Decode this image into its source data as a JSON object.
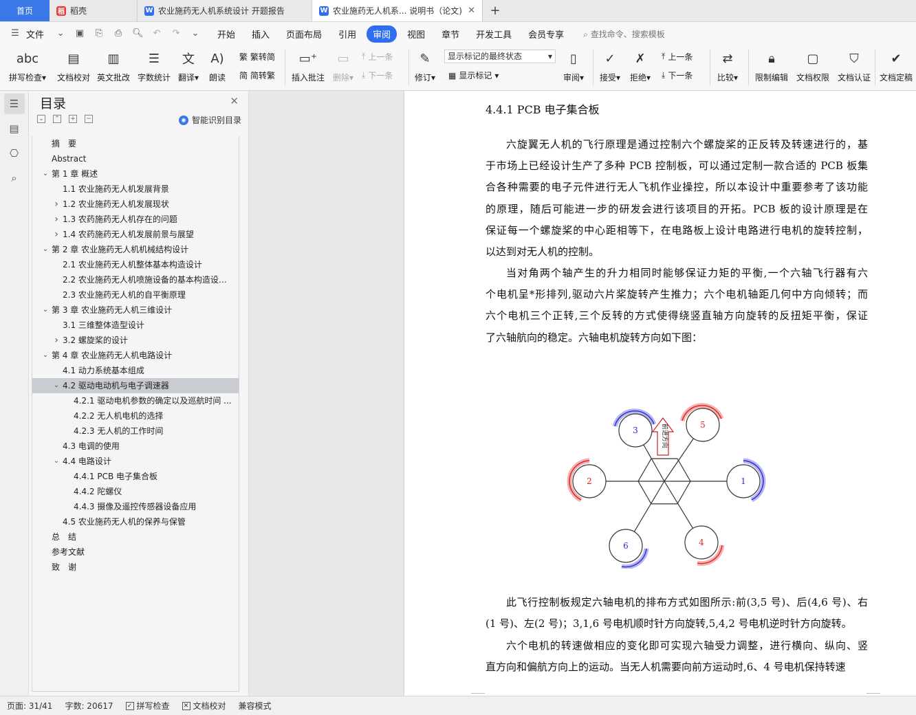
{
  "tabs": [
    {
      "label": "首页",
      "icon": "home-tab"
    },
    {
      "label": "稻壳",
      "icon": "docer-logo-icon"
    },
    {
      "label": "农业施药无人机系统设计 开题报告",
      "icon": "word-doc-icon"
    },
    {
      "label": "农业施药无人机系... 说明书（论文)",
      "icon": "word-doc-icon",
      "active": true
    }
  ],
  "menubar": {
    "file": "文件",
    "items": [
      "开始",
      "插入",
      "页面布局",
      "引用",
      "审阅",
      "视图",
      "章节",
      "开发工具",
      "会员专享"
    ],
    "active": "审阅",
    "search": "查找命令、搜索模板"
  },
  "ribbon": {
    "spell_check": "拼写检查",
    "doc_proof": "文档校对",
    "eng_review": "英文批改",
    "word_count": "字数统计",
    "translate": "翻译",
    "read_aloud": "朗读",
    "trad_to_simp": "繁转简",
    "simp_to_trad": "简转繁",
    "insert_comment": "插入批注",
    "delete": "删除",
    "prev_comment": "上一条",
    "next_comment": "下一条",
    "revise": "修订",
    "markup_state": "显示标记的最终状态",
    "show_markup": "显示标记",
    "review": "审阅",
    "accept": "接受",
    "reject": "拒绝",
    "prev_change": "上一条",
    "next_change": "下一条",
    "compare": "比较",
    "restrict_edit": "限制编辑",
    "doc_permission": "文档权限",
    "doc_certify": "文档认证",
    "doc_finalize": "文档定稿"
  },
  "nav": {
    "title": "目录",
    "smart_toc": "智能识别目录",
    "items": [
      {
        "text": "摘　要",
        "level": 0,
        "arrow": ""
      },
      {
        "text": "Abstract",
        "level": 0,
        "arrow": ""
      },
      {
        "text": "第 1 章  概述",
        "level": 0,
        "arrow": "v"
      },
      {
        "text": "1.1 农业施药无人机发展背景",
        "level": 1,
        "arrow": ""
      },
      {
        "text": "1.2 农业施药无人机发展现状",
        "level": 1,
        "arrow": ">"
      },
      {
        "text": "1.3 农药施药无人机存在的问题",
        "level": 1,
        "arrow": ">"
      },
      {
        "text": "1.4 农药施药无人机发展前景与展望",
        "level": 1,
        "arrow": ">"
      },
      {
        "text": "第 2 章  农业施药无人机机械结构设计",
        "level": 0,
        "arrow": "v"
      },
      {
        "text": "2.1 农业施药无人机整体基本构造设计",
        "level": 1,
        "arrow": ""
      },
      {
        "text": "2.2 农业施药无人机喷施设备的基本构造设计 ...",
        "level": 1,
        "arrow": ""
      },
      {
        "text": "2.3 农业施药无人机的自平衡原理",
        "level": 1,
        "arrow": ""
      },
      {
        "text": "第 3 章  农业施药无人机三维设计",
        "level": 0,
        "arrow": "v"
      },
      {
        "text": "3.1 三维整体造型设计",
        "level": 1,
        "arrow": ""
      },
      {
        "text": "3.2 螺旋桨的设计",
        "level": 1,
        "arrow": ">"
      },
      {
        "text": "第 4 章  农业施药无人机电路设计",
        "level": 0,
        "arrow": "v"
      },
      {
        "text": "4.1 动力系统基本组成",
        "level": 1,
        "arrow": ""
      },
      {
        "text": "4.2 驱动电动机与电子调速器",
        "level": 1,
        "arrow": "v",
        "selected": true
      },
      {
        "text": "4.2.1 驱动电机参数的确定以及巡航时间 ...",
        "level": 2,
        "arrow": ""
      },
      {
        "text": "4.2.2 无人机电机的选择",
        "level": 2,
        "arrow": ""
      },
      {
        "text": "4.2.3 无人机的工作时间",
        "level": 2,
        "arrow": ""
      },
      {
        "text": "4.3 电调的使用",
        "level": 1,
        "arrow": ""
      },
      {
        "text": "4.4 电路设计",
        "level": 1,
        "arrow": "v"
      },
      {
        "text": "4.4.1 PCB 电子集合板",
        "level": 2,
        "arrow": ""
      },
      {
        "text": "4.4.2 陀螺仪",
        "level": 2,
        "arrow": ""
      },
      {
        "text": "4.4.3 摄像及遥控传感器设备应用",
        "level": 2,
        "arrow": ""
      },
      {
        "text": "4.5 农业施药无人机的保养与保管",
        "level": 1,
        "arrow": ""
      },
      {
        "text": "总　结",
        "level": 0,
        "arrow": ""
      },
      {
        "text": "参考文献",
        "level": 0,
        "arrow": ""
      },
      {
        "text": "致　谢",
        "level": 0,
        "arrow": ""
      }
    ]
  },
  "document": {
    "heading": "4.4.1 PCB 电子集合板",
    "para1": [
      "六旋翼无人机的飞行原理是通过控制六个螺旋桨的正反转及转速进行的，基",
      "于市场上已经设计生产了多种 PCB 控制板，可以通过定制一款合适的 PCB 板集",
      "合各种需要的电子元件进行无人飞机作业操控，所以本设计中重要参考了该功能",
      "的原理，随后可能进一步的研发会进行该项目的开拓。PCB 板的设计原理是在",
      "保证每一个螺旋桨的中心距相等下，在电路板上设计电路进行电机的旋转控制，",
      "以达到对无人机的控制。"
    ],
    "para2": [
      "当对角两个轴产生的升力相同时能够保证力矩的平衡,一个六轴飞行器有六",
      "个电机呈*形排列,驱动六片桨旋转产生推力；六个电机轴距几何中方向倾转；而",
      "六个电机三个正转,三个反转的方式使得绕竖直轴方向旋转的反扭矩平衡，保证",
      "了六轴航向的稳定。六轴电机旋转方向如下图："
    ],
    "diagram": {
      "motors": [
        {
          "label": "1",
          "color": "#2a2ad0",
          "dir": "cw"
        },
        {
          "label": "2",
          "color": "#e02020",
          "dir": "ccw"
        },
        {
          "label": "3",
          "color": "#2a2ad0",
          "dir": "cw"
        },
        {
          "label": "4",
          "color": "#e02020",
          "dir": "ccw"
        },
        {
          "label": "5",
          "color": "#e02020",
          "dir": "ccw"
        },
        {
          "label": "6",
          "color": "#2a2ad0",
          "dir": "cw"
        }
      ],
      "forward_label": "前进方向"
    },
    "para3": [
      "此飞行控制板规定六轴电机的排布方式如图所示:前(3,5 号)、后(4,6 号)、右",
      "(1 号)、左(2 号)；3,1,6 号电机顺时针方向旋转,5,4,2 号电机逆时针方向旋转。"
    ],
    "para4": [
      "六个电机的转速做相应的变化即可实现六轴受力调整，进行横向、纵向、竖",
      "直方向和偏航方向上的运动。当无人机需要向前方运动时,6、4 号电机保持转速"
    ]
  },
  "status": {
    "page": "页面: 31/41",
    "words": "字数: 20617",
    "spell": "拼写检查",
    "proof": "文档校对",
    "compat": "兼容模式"
  }
}
